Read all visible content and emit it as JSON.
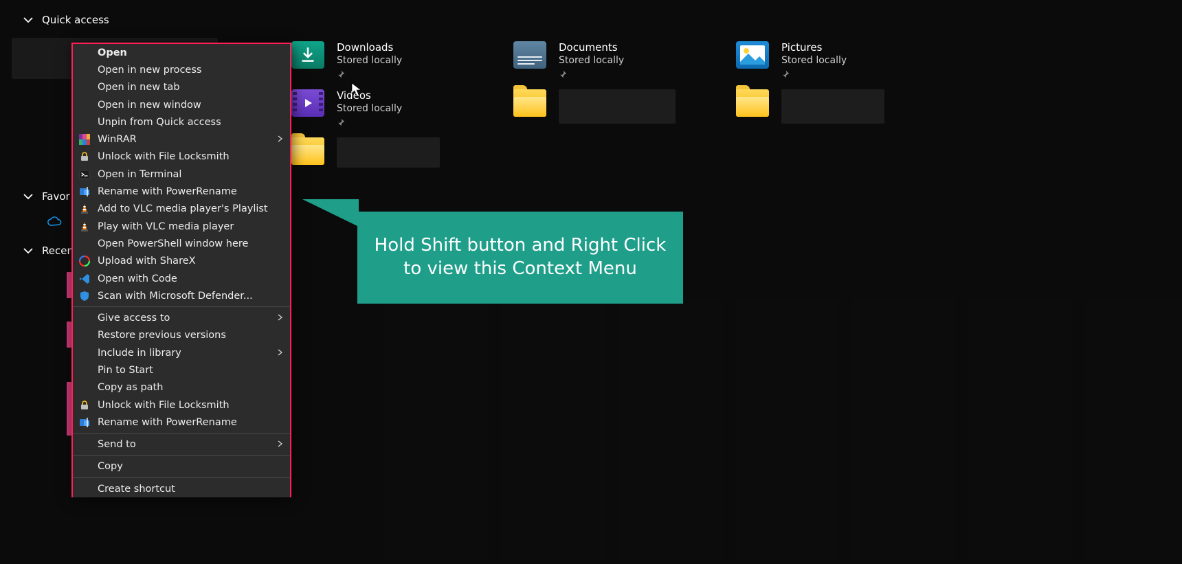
{
  "sections": {
    "quick_access": "Quick access",
    "favorites_trunc": "Favor",
    "recent_trunc": "Recen"
  },
  "qa_items": [
    {
      "key": "downloads",
      "title": "Downloads",
      "sub": "Stored locally",
      "pinned": true,
      "icon": "downloads"
    },
    {
      "key": "documents",
      "title": "Documents",
      "sub": "Stored locally",
      "pinned": true,
      "icon": "documents"
    },
    {
      "key": "pictures",
      "title": "Pictures",
      "sub": "Stored locally",
      "pinned": true,
      "icon": "pictures"
    },
    {
      "key": "videos",
      "title": "Videos",
      "sub": "Stored locally",
      "pinned": true,
      "icon": "videos"
    },
    {
      "key": "redacted1",
      "title": "",
      "sub": "",
      "pinned": false,
      "icon": "yellow",
      "redacted": true
    },
    {
      "key": "redacted2",
      "title": "",
      "sub": "",
      "pinned": false,
      "icon": "yellow",
      "redacted": true
    },
    {
      "key": "redacted3",
      "title": "",
      "sub": "",
      "pinned": false,
      "icon": "yellow",
      "redacted": true
    }
  ],
  "context_menu": {
    "groups": [
      [
        {
          "label": "Open",
          "bold": true,
          "icon": null,
          "sub": false
        },
        {
          "label": "Open in new process",
          "icon": null,
          "sub": false
        },
        {
          "label": "Open in new tab",
          "icon": null,
          "sub": false
        },
        {
          "label": "Open in new window",
          "icon": null,
          "sub": false
        },
        {
          "label": "Unpin from Quick access",
          "icon": null,
          "sub": false
        },
        {
          "label": "WinRAR",
          "icon": "winrar",
          "sub": true
        },
        {
          "label": "Unlock with File Locksmith",
          "icon": "locksmith",
          "sub": false
        },
        {
          "label": "Open in Terminal",
          "icon": "terminal",
          "sub": false
        },
        {
          "label": "Rename with PowerRename",
          "icon": "powerrename",
          "sub": false
        },
        {
          "label": "Add to VLC media player's Playlist",
          "icon": "vlc",
          "sub": false
        },
        {
          "label": "Play with VLC media player",
          "icon": "vlc",
          "sub": false
        },
        {
          "label": "Open PowerShell window here",
          "icon": null,
          "sub": false
        },
        {
          "label": "Upload with ShareX",
          "icon": "sharex",
          "sub": false
        },
        {
          "label": "Open with Code",
          "icon": "vscode",
          "sub": false
        },
        {
          "label": "Scan with Microsoft Defender...",
          "icon": "defender",
          "sub": false
        }
      ],
      [
        {
          "label": "Give access to",
          "icon": null,
          "sub": true
        },
        {
          "label": "Restore previous versions",
          "icon": null,
          "sub": false
        },
        {
          "label": "Include in library",
          "icon": null,
          "sub": true
        },
        {
          "label": "Pin to Start",
          "icon": null,
          "sub": false
        },
        {
          "label": "Copy as path",
          "icon": null,
          "sub": false
        },
        {
          "label": "Unlock with File Locksmith",
          "icon": "locksmith",
          "sub": false
        },
        {
          "label": "Rename with PowerRename",
          "icon": "powerrename",
          "sub": false
        }
      ],
      [
        {
          "label": "Send to",
          "icon": null,
          "sub": true
        }
      ],
      [
        {
          "label": "Copy",
          "icon": null,
          "sub": false
        }
      ],
      [
        {
          "label": "Create shortcut",
          "icon": null,
          "sub": false
        }
      ]
    ]
  },
  "callout_text": "Hold Shift button and Right Click to view this Context Menu",
  "icons": {
    "winrar_colors": [
      "#7a2ea0",
      "#d94d8c",
      "#e8b03b",
      "#3bb36e",
      "#2e7dd6"
    ]
  }
}
